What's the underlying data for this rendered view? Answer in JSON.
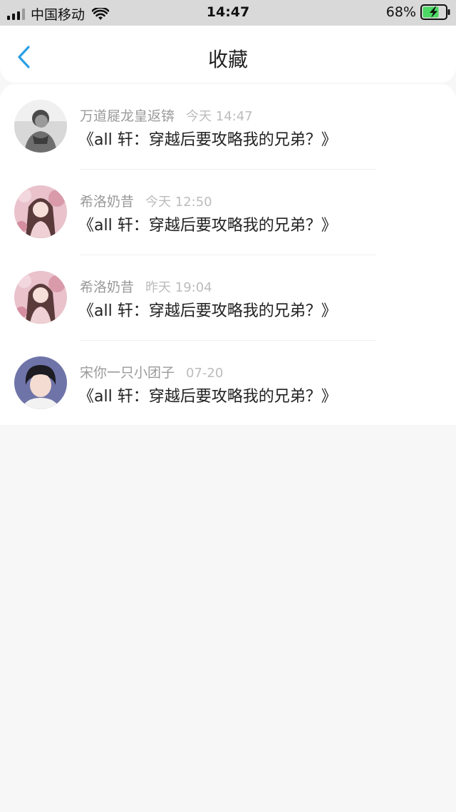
{
  "status_bar": {
    "carrier": "中国移动",
    "time": "14:47",
    "battery": "68%"
  },
  "nav": {
    "title": "收藏",
    "back_icon": "chevron-left-icon",
    "accent": "#2aa0e6"
  },
  "favorites": [
    {
      "author": "万道屣龙皇返锛",
      "time": "今天 14:47",
      "title": "《all 轩：穿越后要攻略我的兄弟？》"
    },
    {
      "author": "希洛奶昔",
      "time": "今天 12:50",
      "title": "《all 轩：穿越后要攻略我的兄弟？》"
    },
    {
      "author": "希洛奶昔",
      "time": "昨天 19:04",
      "title": "《all 轩：穿越后要攻略我的兄弟？》"
    },
    {
      "author": "宋你一只小团子",
      "time": "07-20",
      "title": "《all 轩：穿越后要攻略我的兄弟？》"
    }
  ]
}
